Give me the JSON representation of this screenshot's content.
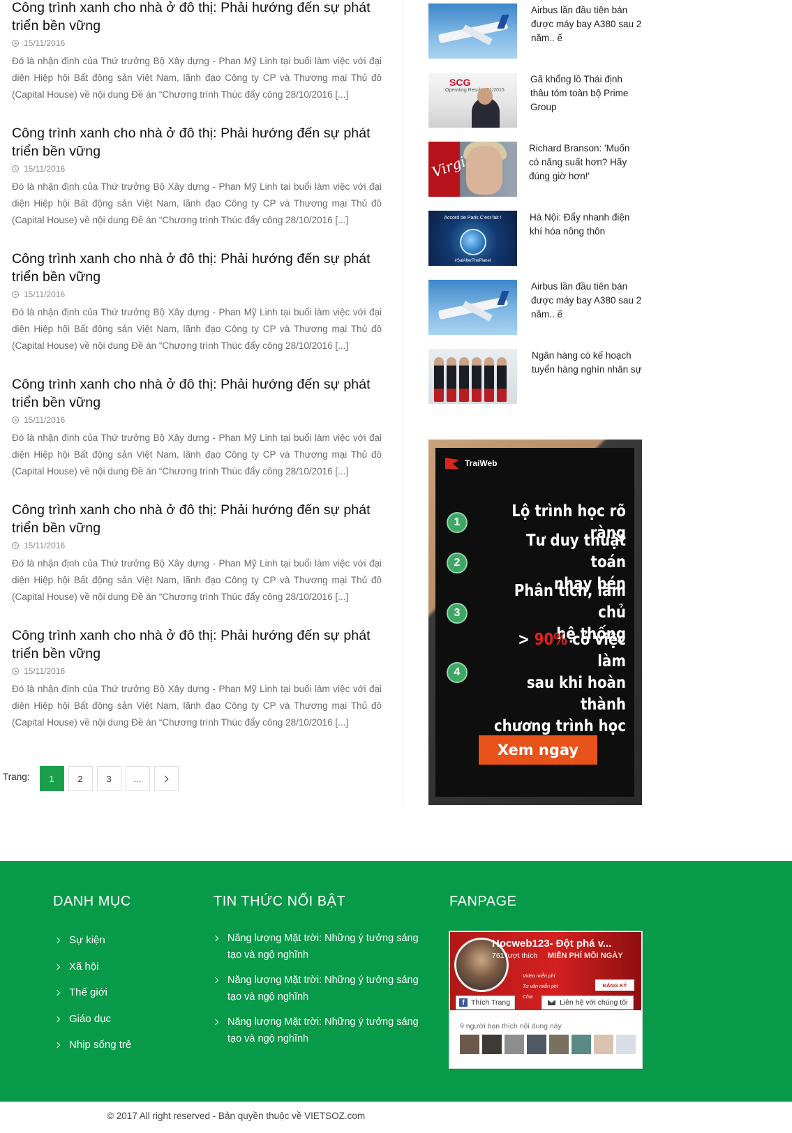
{
  "articles": [
    {
      "title": "Công trình xanh cho nhà ở đô thị: Phải hướng đến sự phát triển bền vững",
      "date": "15/11/2016",
      "excerpt": "Đó là nhận định của Thứ trưởng Bộ Xây dựng - Phan Mỹ Linh tại buổi làm việc với đại diện Hiệp hội Bất động sản Việt Nam, lãnh đạo Công ty CP và Thương mại Thủ đô (Capital House) về nội dung Đề án “Chương trình Thúc đẩy công 28/10/2016 [...]"
    },
    {
      "title": "Công trình xanh cho nhà ở đô thị: Phải hướng đến sự phát triển bền vững",
      "date": "15/11/2016",
      "excerpt": "Đó là nhận định của Thứ trưởng Bộ Xây dựng - Phan Mỹ Linh tại buổi làm việc với đại diện Hiệp hội Bất động sản Việt Nam, lãnh đạo Công ty CP và Thương mại Thủ đô (Capital House) về nội dung Đề án “Chương trình Thúc đẩy công 28/10/2016 [...]"
    },
    {
      "title": "Công trình xanh cho nhà ở đô thị: Phải hướng đến sự phát triển bền vững",
      "date": "15/11/2016",
      "excerpt": "Đó là nhận định của Thứ trưởng Bộ Xây dựng - Phan Mỹ Linh tại buổi làm việc với đại diện Hiệp hội Bất động sản Việt Nam, lãnh đạo Công ty CP và Thương mại Thủ đô (Capital House) về nội dung Đề án “Chương trình Thúc đẩy công 28/10/2016 [...]"
    },
    {
      "title": "Công trình xanh cho nhà ở đô thị: Phải hướng đến sự phát triển bền vững",
      "date": "15/11/2016",
      "excerpt": "Đó là nhận định của Thứ trưởng Bộ Xây dựng - Phan Mỹ Linh tại buổi làm việc với đại diện Hiệp hội Bất động sản Việt Nam, lãnh đạo Công ty CP và Thương mại Thủ đô (Capital House) về nội dung Đề án “Chương trình Thúc đẩy công 28/10/2016 [...]"
    },
    {
      "title": "Công trình xanh cho nhà ở đô thị: Phải hướng đến sự phát triển bền vững",
      "date": "15/11/2016",
      "excerpt": "Đó là nhận định của Thứ trưởng Bộ Xây dựng - Phan Mỹ Linh tại buổi làm việc với đại diện Hiệp hội Bất động sản Việt Nam, lãnh đạo Công ty CP và Thương mại Thủ đô (Capital House) về nội dung Đề án “Chương trình Thúc đẩy công 28/10/2016 [...]"
    },
    {
      "title": "Công trình xanh cho nhà ở đô thị: Phải hướng đến sự phát triển bền vững",
      "date": "15/11/2016",
      "excerpt": "Đó là nhận định của Thứ trưởng Bộ Xây dựng - Phan Mỹ Linh tại buổi làm việc với đại diện Hiệp hội Bất động sản Việt Nam, lãnh đạo Công ty CP và Thương mại Thủ đô (Capital House) về nội dung Đề án “Chương trình Thúc đẩy công 28/10/2016 [...]"
    }
  ],
  "pagination": {
    "label": "Trang:",
    "pages": [
      "1",
      "2",
      "3",
      "..."
    ],
    "current": "1",
    "next_icon": "chevron-right-icon"
  },
  "sidebar_news": [
    {
      "title": "Airbus lần đầu tiên bán được máy bay A380 sau 2 năm.. ế"
    },
    {
      "title": "Gã khổng lồ Thái định thâu tóm toàn bộ Prime Group",
      "thumb_logo": "SCG",
      "thumb_sub": "Operating Results Q1/2015"
    },
    {
      "title": "Richard Branson: 'Muốn có năng suất hơn? Hãy đúng giờ hơn!'",
      "thumb_logo": "Virgin"
    },
    {
      "title": "Hà Nội: Đẩy nhanh điện khí hóa nông thôn",
      "thumb_text": "Accord de Paris C'est fait !",
      "thumb_tag": "#SaiAfterThePlanet"
    },
    {
      "title": "Airbus lần đầu tiên bán được máy bay A380 sau 2 năm.. ế"
    },
    {
      "title": "Ngân hàng có kế hoạch tuyển hàng nghìn nhân sự"
    }
  ],
  "ad": {
    "brand": "TraiWeb",
    "items": [
      {
        "num": "1",
        "text": "Lộ trình học rõ ràng"
      },
      {
        "num": "2",
        "text_lines": [
          "Tư duy thuật toán",
          "nhạy bén"
        ]
      },
      {
        "num": "3",
        "text_lines": [
          "Phân tích, làm chủ",
          "hệ thống"
        ]
      },
      {
        "num": "4",
        "prefix": "> ",
        "highlight": "90%",
        "rest": " có việc làm",
        "text_lines": [
          "sau khi hoàn thành",
          "chương trình học"
        ]
      }
    ],
    "cta": "Xem ngay",
    "highlight_color": "#e3211d",
    "cta_color": "#e8521b"
  },
  "footer": {
    "background": "#079a48",
    "categories": {
      "title": "DANH MỤC",
      "items": [
        "Sự kiện",
        "Xã hội",
        "Thế giới",
        "Giáo dục",
        "Nhịp sống trẻ"
      ]
    },
    "featured": {
      "title": "TIN THỨC NỔI BẬT",
      "items": [
        "Năng lượng Mặt trời: Những ý tưởng sáng tạo và ngộ nghĩnh",
        "Năng lượng Mặt trời: Những ý tưởng sáng tạo và ngộ nghĩnh",
        "Năng lượng Mặt trời: Những ý tưởng sáng tạo và ngộ nghĩnh"
      ]
    },
    "fanpage": {
      "title": "FANPAGE",
      "page_name": "Hocweb123- Đột phá v...",
      "likes": "761 lượt thích",
      "banner_text": "MIỄN PHÍ MỖI NGÀY",
      "bullets": [
        "Video miễn phí",
        "Tư vấn miễn phí",
        "Chia"
      ],
      "sign_up": "ĐĂNG KÝ",
      "like_button": "Thích Trang",
      "contact_button": "Liên hệ với chúng tôi",
      "friends_text": "9 người bạn thích nội dung này"
    },
    "copyright": "© 2017 All right reserved - Bản quyền thuộc về VIETSOZ.com"
  },
  "colors": {
    "accent": "#1aa04c",
    "footer_bg": "#079a48"
  }
}
